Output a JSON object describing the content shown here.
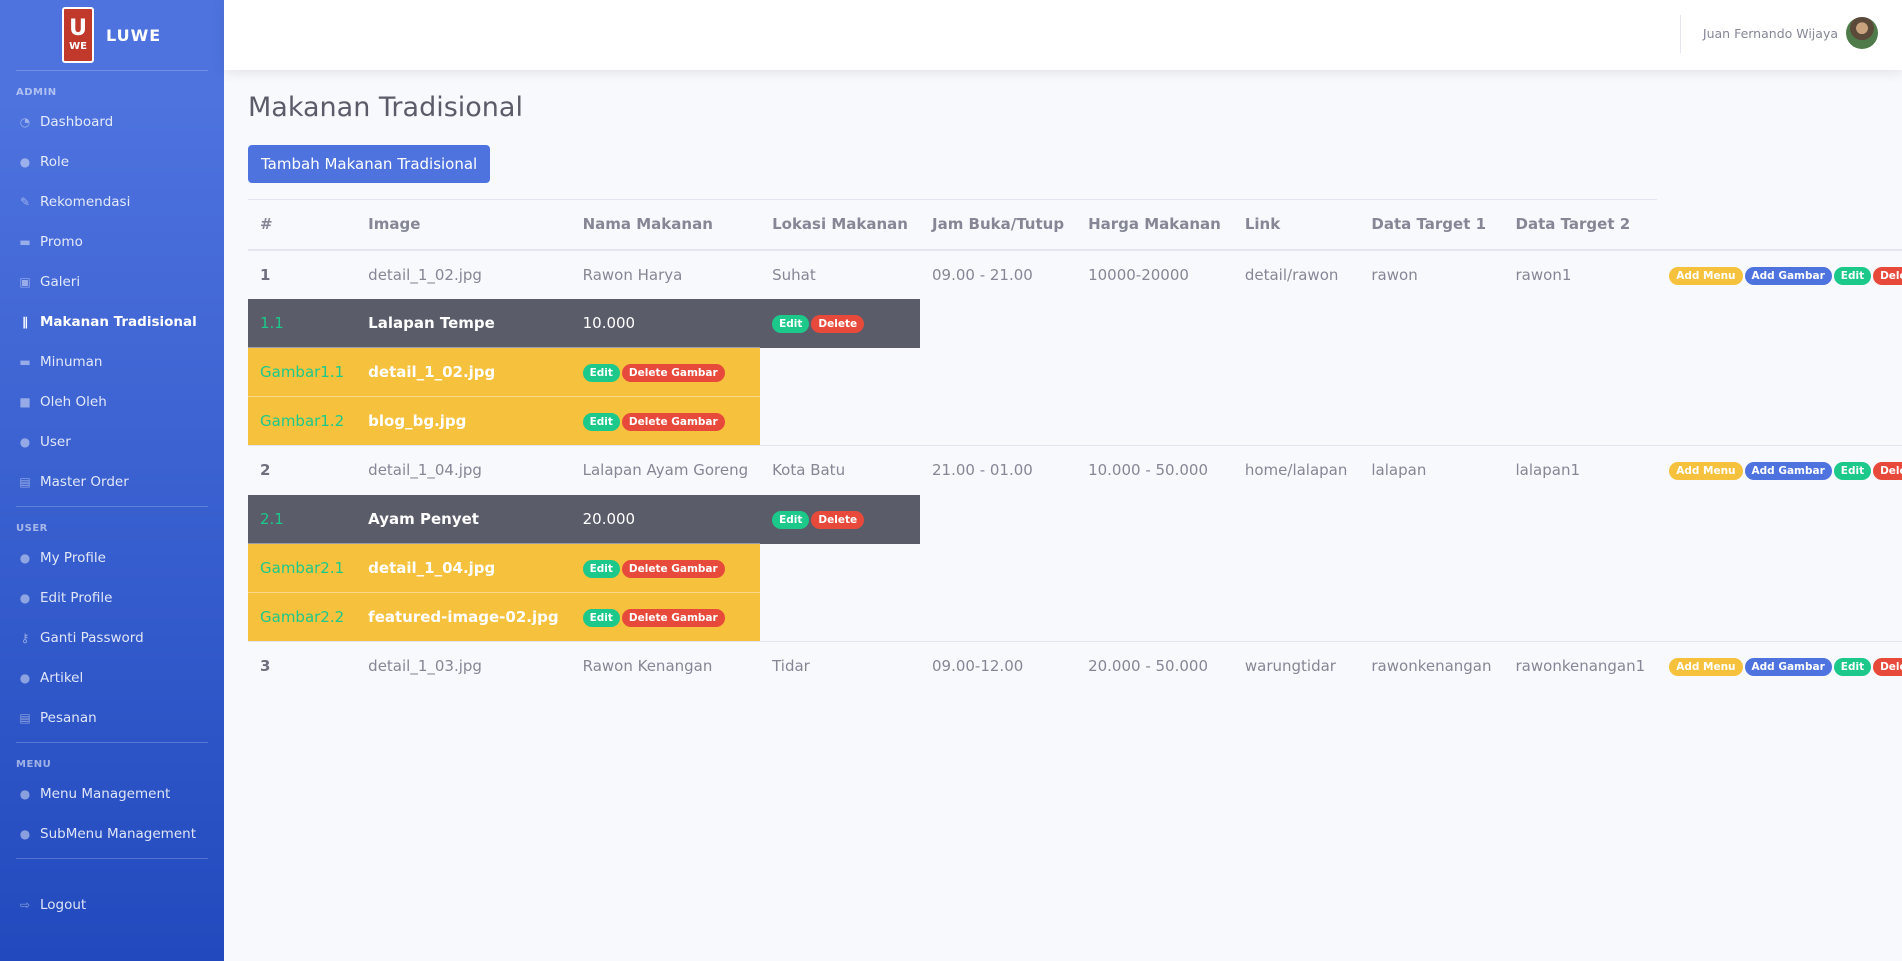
{
  "brand": {
    "logo_top": "U",
    "logo_bottom": "WE",
    "name": "LUWE"
  },
  "sidebar": {
    "admin_heading": "ADMIN",
    "admin_items": [
      {
        "label": "Dashboard",
        "icon": "tachometer-icon"
      },
      {
        "label": "Role",
        "icon": "user-icon"
      },
      {
        "label": "Rekomendasi",
        "icon": "pen-icon"
      },
      {
        "label": "Promo",
        "icon": "tag-icon"
      },
      {
        "label": "Galeri",
        "icon": "images-icon"
      },
      {
        "label": "Makanan Tradisional",
        "icon": "utensils-icon",
        "active": true
      },
      {
        "label": "Minuman",
        "icon": "coffee-icon"
      },
      {
        "label": "Oleh Oleh",
        "icon": "box-icon"
      },
      {
        "label": "User",
        "icon": "users-icon"
      },
      {
        "label": "Master Order",
        "icon": "cart-icon"
      }
    ],
    "user_heading": "USER",
    "user_items": [
      {
        "label": "My Profile",
        "icon": "user-icon"
      },
      {
        "label": "Edit Profile",
        "icon": "user-edit-icon"
      },
      {
        "label": "Ganti Password",
        "icon": "key-icon"
      },
      {
        "label": "Artikel",
        "icon": "comments-icon"
      },
      {
        "label": "Pesanan",
        "icon": "cart-icon"
      }
    ],
    "menu_heading": "MENU",
    "menu_items": [
      {
        "label": "Menu Management",
        "icon": "users-cog-icon"
      },
      {
        "label": "SubMenu Management",
        "icon": "users-cog-icon"
      }
    ],
    "logout": "Logout"
  },
  "topbar": {
    "username": "Juan Fernando Wijaya"
  },
  "page": {
    "title": "Makanan Tradisional",
    "add_button": "Tambah Makanan Tradisional"
  },
  "table": {
    "headers": [
      "#",
      "Image",
      "Nama Makanan",
      "Lokasi Makanan",
      "Jam Buka/Tutup",
      "Harga Makanan",
      "Link",
      "Data Target 1",
      "Data Target 2"
    ],
    "actions": {
      "add_menu": "Add Menu",
      "add_gambar": "Add Gambar",
      "edit": "Edit",
      "delete": "Delete",
      "delete_gambar": "Delete Gambar"
    },
    "rows": [
      {
        "no": "1",
        "image": "detail_1_02.jpg",
        "nama": "Rawon Harya",
        "lokasi": "Suhat",
        "jam": "09.00 - 21.00",
        "harga": "10000-20000",
        "link": "detail/rawon",
        "t1": "rawon",
        "t2": "rawon1",
        "menu": {
          "no": "1.1",
          "nama": "Lalapan Tempe",
          "harga": "10.000"
        },
        "gambar": [
          {
            "no": "Gambar1.1",
            "file": "detail_1_02.jpg"
          },
          {
            "no": "Gambar1.2",
            "file": "blog_bg.jpg"
          }
        ]
      },
      {
        "no": "2",
        "image": "detail_1_04.jpg",
        "nama": "Lalapan Ayam Goreng",
        "lokasi": "Kota Batu",
        "jam": "21.00 - 01.00",
        "harga": "10.000 - 50.000",
        "link": "home/lalapan",
        "t1": "lalapan",
        "t2": "lalapan1",
        "menu": {
          "no": "2.1",
          "nama": "Ayam Penyet",
          "harga": "20.000"
        },
        "gambar": [
          {
            "no": "Gambar2.1",
            "file": "detail_1_04.jpg"
          },
          {
            "no": "Gambar2.2",
            "file": "featured-image-02.jpg"
          }
        ]
      },
      {
        "no": "3",
        "image": "detail_1_03.jpg",
        "nama": "Rawon Kenangan",
        "lokasi": "Tidar",
        "jam": "09.00-12.00",
        "harga": "20.000 - 50.000",
        "link": "warungtidar",
        "t1": "rawonkenangan",
        "t2": "rawonkenangan1"
      }
    ]
  }
}
